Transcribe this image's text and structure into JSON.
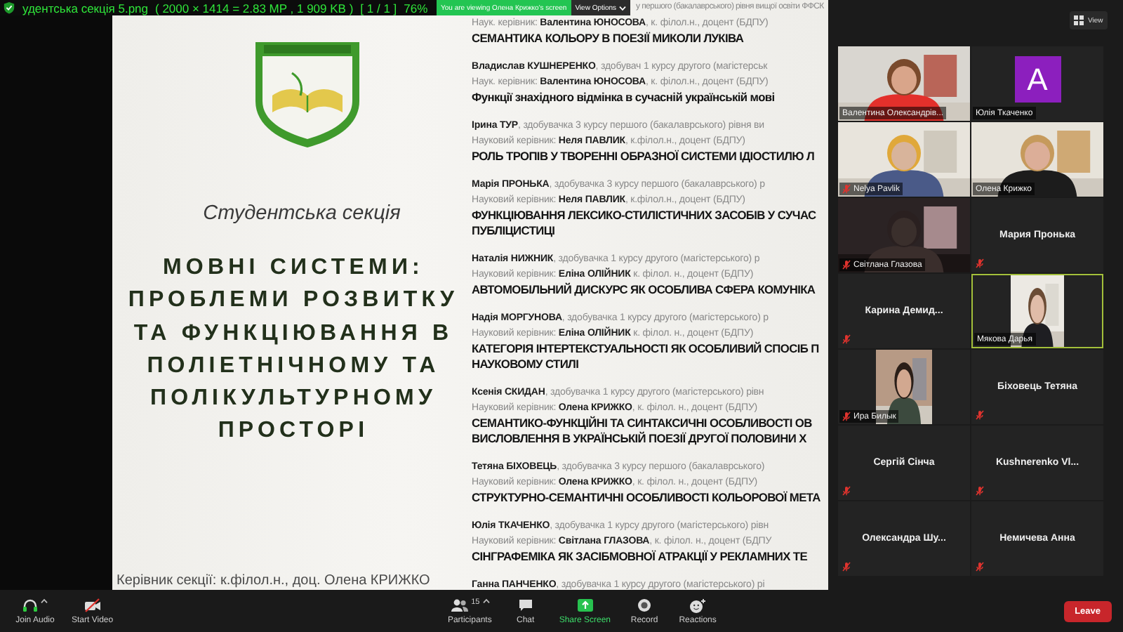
{
  "viewer": {
    "header_parts": [
      "удентська секція 5.png",
      "( 2000 × 1414 = 2.83 MP  ,  1 909 KB )",
      "[ 1 / 1 ]",
      "76%"
    ]
  },
  "share_banner": {
    "text": "You are viewing Олена Крижко's screen",
    "options": "View Options"
  },
  "view_button": "View",
  "poster": {
    "section_label": "Студентська секція",
    "title_lines": [
      "МОВНІ СИСТЕМИ:",
      "ПРОБЛЕМИ РОЗВИТКУ",
      "ТА ФУНКЦІЮВАННЯ В",
      "ПОЛІЕТНІЧНОМУ ТА",
      "ПОЛІКУЛЬТУРНОМУ",
      "ПРОСТОРІ"
    ],
    "head": "Керівник секції: к.філол.н., доц. Олена КРИЖКО",
    "talks": [
      {
        "student": "у першого (бакалаврського) рівня вищої освіти ФФСК",
        "supervisor": "Наук. керівник: **Валентина ЮНОСОВА**, к. філол.н., доцент (БДПУ)",
        "title_lines": [
          "СЕМАНТИКА КОЛЬОРУ В ПОЕЗІЇ МИКОЛИ ЛУКІВА"
        ]
      },
      {
        "student": "**Владислав КУШНЕРЕНКО**, здобувач 1 курсу другого (магістерськ",
        "supervisor": "Наук. керівник: **Валентина ЮНОСОВА**, к. філол.н., доцент (БДПУ)",
        "title_lines": [
          "Функції знахідного відмінка в сучасній українській мові"
        ]
      },
      {
        "student": "**Ірина ТУР**, здобувачка 3 курсу першого (бакалаврського) рівня ви",
        "supervisor": "Науковий керівник: **Неля ПАВЛИК**, к.філол.н., доцент (БДПУ)",
        "title_lines": [
          "РОЛЬ ТРОПІВ У ТВОРЕННІ ОБРАЗНОЇ СИСТЕМИ ІДІОСТИЛЮ Л"
        ]
      },
      {
        "student": "**Марія ПРОНЬКА**, здобувачка 3 курсу першого (бакалаврського) р",
        "supervisor": "Науковий керівник: **Неля ПАВЛИК**, к.філол.н., доцент (БДПУ)",
        "title_lines": [
          "ФУНКЦІЮВАННЯ ЛЕКСИКО-СТИЛІСТИЧНИХ ЗАСОБІВ У СУЧАС",
          "ПУБЛІЦИСТИЦІ"
        ]
      },
      {
        "student": "**Наталія НИЖНИК**, здобувачка 1 курсу другого (магістерського) р",
        "supervisor": "Науковий керівник: **Еліна ОЛІЙНИК** к. філол. н., доцент (БДПУ)",
        "title_lines": [
          "АВТОМОБІЛЬНИЙ ДИСКУРС ЯК ОСОБЛИВА СФЕРА КОМУНІКА"
        ]
      },
      {
        "student": "**Надія МОРГУНОВА**, здобувачка 1 курсу другого (магістерського) р",
        "supervisor": "Науковий керівник: **Еліна ОЛІЙНИК** к. філол. н., доцент (БДПУ)",
        "title_lines": [
          "КАТЕГОРІЯ ІНТЕРТЕКСТУАЛЬНОСТІ ЯК ОСОБЛИВИЙ СПОСІБ П",
          "НАУКОВОМУ СТИЛІ"
        ]
      },
      {
        "student": "**Ксенія СКИДАН**, здобувачка 1 курсу другого (магістерського) рівн",
        "supervisor": "Науковий керівник: **Олена КРИЖКО**, к. філол. н., доцент (БДПУ)",
        "title_lines": [
          "СЕМАНТИКО-ФУНКЦІЙНІ ТА СИНТАКСИЧНІ ОСОБЛИВОСТІ ОВ",
          "ВИСЛОВЛЕННЯ В УКРАЇНСЬКІЙ ПОЕЗІЇ  ДРУГОЇ ПОЛОВИНИ Х"
        ]
      },
      {
        "student": "**Тетяна БІХОВЕЦЬ**, здобувачка 3 курсу першого (бакалаврського)",
        "supervisor": "Науковий керівник: **Олена КРИЖКО**, к. філол. н., доцент (БДПУ)",
        "title_lines": [
          "СТРУКТУРНО-СЕМАНТИЧНІ ОСОБЛИВОСТІ КОЛЬОРОВОЇ МЕТА"
        ]
      },
      {
        "student": "**Юлія ТКАЧЕНКО**, здобувачка 1 курсу другого (магістерського) рівн",
        "supervisor": "Науковий керівник: **Світлана ГЛАЗОВА**, к. філол. н., доцент (БДПУ",
        "title_lines": [
          "СІНГРАФЕМІКА ЯК ЗАСІБМОВНОЇ АТРАКЦІЇ У РЕКЛАМНИХ ТЕ"
        ]
      },
      {
        "student": "**Ганна ПАНЧЕНКО**, здобувачка 1 курсу другого (магістерського) рі"
      }
    ]
  },
  "gallery": {
    "tiles": [
      {
        "name": "Валентина Олександрів...",
        "kind": "video",
        "muted": false,
        "speaking": false
      },
      {
        "name": "Юлія Ткаченко",
        "kind": "avatar",
        "avatar_letter": "A",
        "muted": false,
        "speaking": false
      },
      {
        "name": "Nelya Pavlik",
        "kind": "video",
        "muted": true,
        "speaking": false
      },
      {
        "name": "Олена Крижко",
        "kind": "video",
        "muted": false,
        "speaking": false
      },
      {
        "name": "Світлана Глазова",
        "kind": "video",
        "muted": true,
        "speaking": false
      },
      {
        "name": "Мария Пронька",
        "kind": "name",
        "muted": true,
        "speaking": false
      },
      {
        "name": "Карина Демид...",
        "kind": "name",
        "muted": true,
        "speaking": false
      },
      {
        "name": "Мякова Дарья",
        "kind": "narrow_video",
        "muted": false,
        "speaking": true
      },
      {
        "name": "Ира Билык",
        "kind": "narrow_video",
        "muted": true,
        "speaking": false
      },
      {
        "name": "Біховець Тетяна",
        "kind": "name",
        "muted": true,
        "speaking": false
      },
      {
        "name": "Сергій Сінча",
        "kind": "name",
        "muted": true,
        "speaking": false
      },
      {
        "name": "Kushnerenko Vl...",
        "kind": "name",
        "muted": true,
        "speaking": false
      },
      {
        "name": "Олександра Шу...",
        "kind": "name",
        "muted": true,
        "speaking": false
      },
      {
        "name": "Немичева Анна",
        "kind": "name",
        "muted": true,
        "speaking": false
      }
    ]
  },
  "toolbar": {
    "left": [
      {
        "kind": "audio",
        "label": "Join Audio",
        "caret": true
      },
      {
        "kind": "video",
        "label": "Start Video",
        "caret": false
      }
    ],
    "center": [
      {
        "kind": "participants",
        "label": "Participants",
        "count": "15",
        "caret": true
      },
      {
        "kind": "chat",
        "label": "Chat",
        "caret": false
      },
      {
        "kind": "share",
        "label": "Share Screen",
        "caret": false
      },
      {
        "kind": "record",
        "label": "Record",
        "caret": false
      },
      {
        "kind": "reactions",
        "label": "Reactions",
        "caret": false
      }
    ],
    "leave": "Leave"
  }
}
